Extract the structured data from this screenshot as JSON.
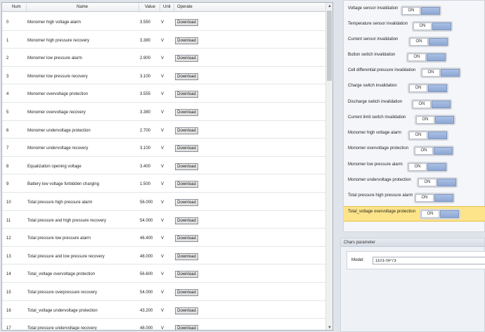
{
  "table": {
    "headers": [
      "Num",
      "Name",
      "Value",
      "Unit",
      "Operate"
    ],
    "button_label": "Download",
    "rows": [
      {
        "num": "0",
        "name": "Monomer high voltage alarm",
        "value": "3.550",
        "unit": "V"
      },
      {
        "num": "1",
        "name": "Monomer high pressure recovery",
        "value": "3.380",
        "unit": "V"
      },
      {
        "num": "2",
        "name": "Monomer low pressure alarm",
        "value": "2.900",
        "unit": "V"
      },
      {
        "num": "3",
        "name": "Monomer low pressure recovery",
        "value": "3.100",
        "unit": "V"
      },
      {
        "num": "4",
        "name": "Monomer overvoltage protection",
        "value": "3.555",
        "unit": "V"
      },
      {
        "num": "5",
        "name": "Monomer overvoltage recovery",
        "value": "3.380",
        "unit": "V"
      },
      {
        "num": "6",
        "name": "Monomer undervoltage protection",
        "value": "2.700",
        "unit": "V"
      },
      {
        "num": "7",
        "name": "Monomer undervoltage recovery",
        "value": "3.100",
        "unit": "V"
      },
      {
        "num": "8",
        "name": "Equalization opening voltage",
        "value": "3.400",
        "unit": "V"
      },
      {
        "num": "9",
        "name": "Battery low voltage forbidden charging",
        "value": "1.500",
        "unit": "V"
      },
      {
        "num": "10",
        "name": "Total pressure high pressure alarm",
        "value": "56.000",
        "unit": "V"
      },
      {
        "num": "11",
        "name": "Total pressure and high pressure recovery",
        "value": "54.000",
        "unit": "V"
      },
      {
        "num": "12",
        "name": "Total pressure low pressure alarm",
        "value": "46.400",
        "unit": "V"
      },
      {
        "num": "13",
        "name": "Total pressure and low pressure recovery",
        "value": "48.000",
        "unit": "V"
      },
      {
        "num": "14",
        "name": "Total_voltage overvoltage protection",
        "value": "56.600",
        "unit": "V"
      },
      {
        "num": "15",
        "name": "Total pressure overpressure recovery",
        "value": "54.000",
        "unit": "V"
      },
      {
        "num": "16",
        "name": "Total_voltage undervoltage protection",
        "value": "43.200",
        "unit": "V"
      },
      {
        "num": "17",
        "name": "Total pressure undervoltage recovery",
        "value": "48.000",
        "unit": "V"
      }
    ]
  },
  "flags": {
    "toggle_label": "ON",
    "items": [
      {
        "label": "Voltage sensor invalidation",
        "highlighted": false
      },
      {
        "label": "Temperature sensor invalidation",
        "highlighted": false
      },
      {
        "label": "Current sensor invalidation",
        "highlighted": false
      },
      {
        "label": "Button switch invalidation",
        "highlighted": false
      },
      {
        "label": "Cell differential pressure invalidation",
        "highlighted": false
      },
      {
        "label": "Charge switch invalidation",
        "highlighted": false
      },
      {
        "label": "Discharge switch invalidation",
        "highlighted": false
      },
      {
        "label": "Current limit switch invalidation",
        "highlighted": false
      },
      {
        "label": "Monomer high voltage alarm",
        "highlighted": false
      },
      {
        "label": "Monomer overvoltage protection",
        "highlighted": false
      },
      {
        "label": "Monomer low pressure alarm",
        "highlighted": false
      },
      {
        "label": "Monomer undervoltage protection",
        "highlighted": false
      },
      {
        "label": "Total pressure high pressure alarm",
        "highlighted": false
      },
      {
        "label": "Total_voltage overvoltage protection",
        "highlighted": true
      }
    ]
  },
  "chars": {
    "title": "Chars parameter",
    "model_label": "Model:",
    "model_value": "1101-SP73"
  },
  "colors": {
    "toggle_knob": "#8ea8d4",
    "highlight_row": "#fde48a"
  }
}
